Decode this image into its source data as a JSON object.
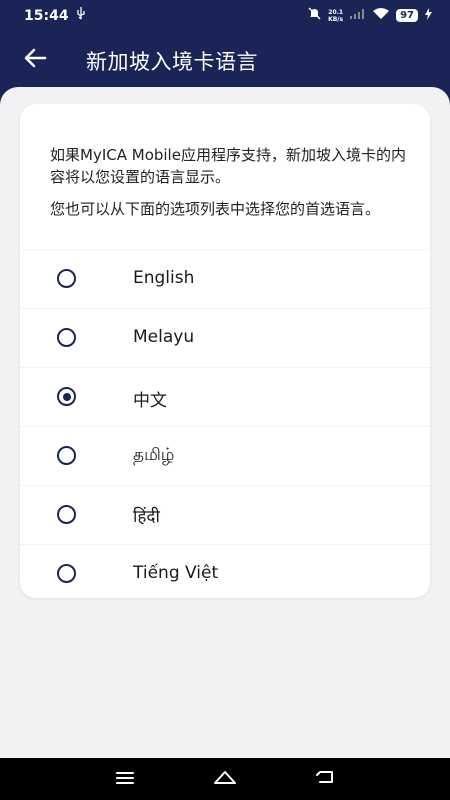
{
  "status_bar": {
    "time": "15:44",
    "usb_icon": "usb-icon",
    "net_speed_value": "20.1",
    "net_speed_unit": "KB/s",
    "battery": "97"
  },
  "header": {
    "title": "新加坡入境卡语言",
    "back_icon": "arrow-left-icon"
  },
  "card": {
    "intro_1": "如果MyICA Mobile应用程序支持，新加坡入境卡的内容将以您设置的语言显示。",
    "intro_2": "您也可以从下面的选项列表中选择您的首选语言。",
    "options": [
      {
        "label": "English",
        "selected": false
      },
      {
        "label": "Melayu",
        "selected": false
      },
      {
        "label": "中文",
        "selected": true
      },
      {
        "label": "தமிழ்",
        "selected": false
      },
      {
        "label": "हिंदी",
        "selected": false
      },
      {
        "label": "Tiếng Việt",
        "selected": false
      }
    ]
  },
  "colors": {
    "primary": "#1b2456",
    "background": "#f2f2f4",
    "card": "#ffffff"
  },
  "nav": {
    "menu_icon": "menu-icon",
    "home_icon": "home-icon",
    "back_icon": "back-return-icon"
  }
}
